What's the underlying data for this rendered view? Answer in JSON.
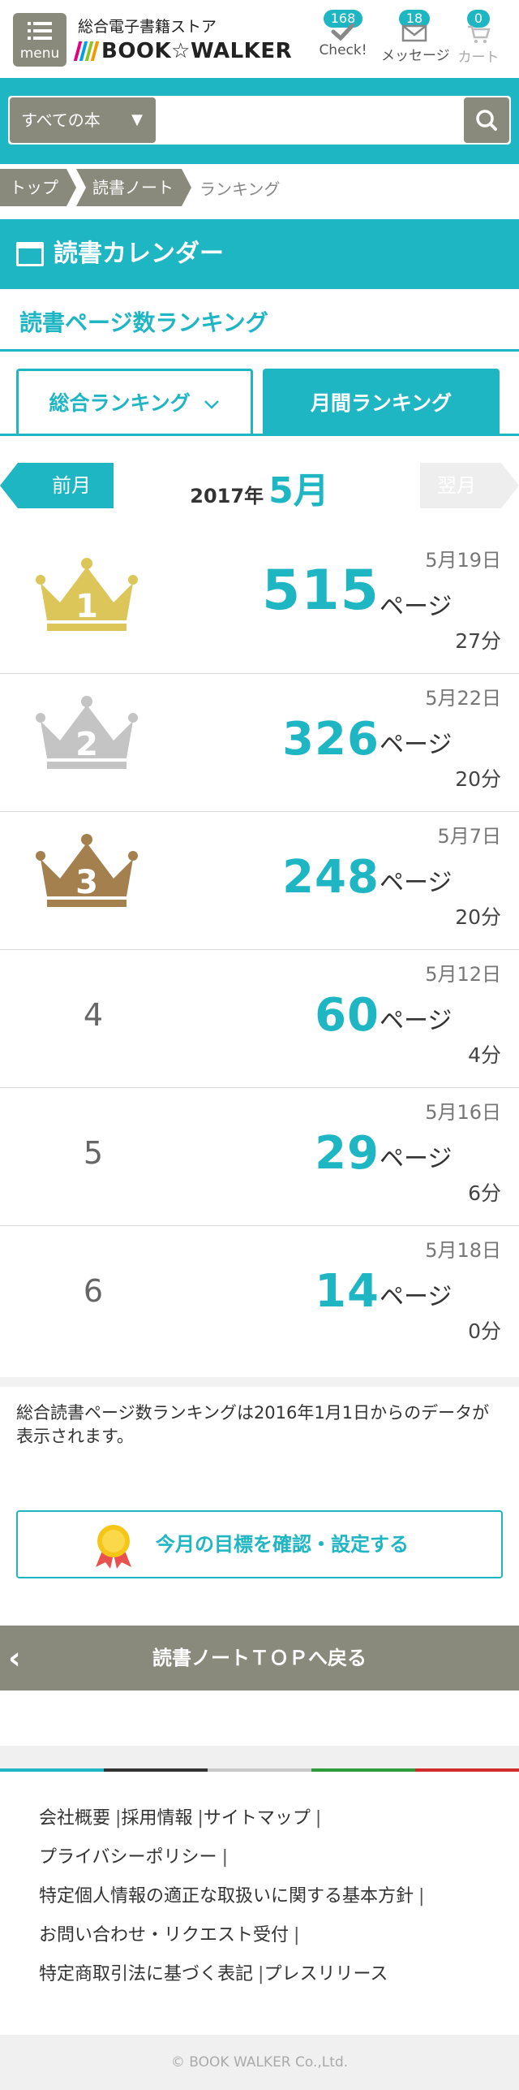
{
  "header": {
    "menu_label": "menu",
    "store_subtitle": "総合電子書籍ストア",
    "logo_text": "BOOK☆WALKER",
    "check": {
      "badge": "168",
      "label": "Check!"
    },
    "messages": {
      "badge": "18",
      "label": "メッセージ"
    },
    "cart": {
      "badge": "0",
      "label": "カート"
    }
  },
  "search": {
    "category": "すべての本",
    "placeholder": ""
  },
  "breadcrumb": {
    "items": [
      "トップ",
      "読書ノート"
    ],
    "current": "ランキング"
  },
  "section": {
    "title": "読書カレンダー",
    "subtitle": "読書ページ数ランキング"
  },
  "tabs": {
    "overall": "総合ランキング",
    "monthly": "月間ランキング"
  },
  "month_nav": {
    "prev": "前月",
    "next": "翌月",
    "year": "2017年",
    "month": "5月"
  },
  "rankings": [
    {
      "rank": "1",
      "date": "5月19日",
      "pages": "515",
      "unit": "ページ",
      "minutes": "27分"
    },
    {
      "rank": "2",
      "date": "5月22日",
      "pages": "326",
      "unit": "ページ",
      "minutes": "20分"
    },
    {
      "rank": "3",
      "date": "5月7日",
      "pages": "248",
      "unit": "ページ",
      "minutes": "20分"
    },
    {
      "rank": "4",
      "date": "5月12日",
      "pages": "60",
      "unit": "ページ",
      "minutes": "4分"
    },
    {
      "rank": "5",
      "date": "5月16日",
      "pages": "29",
      "unit": "ページ",
      "minutes": "6分"
    },
    {
      "rank": "6",
      "date": "5月18日",
      "pages": "14",
      "unit": "ページ",
      "minutes": "0分"
    }
  ],
  "note": "総合読書ページ数ランキングは2016年1月1日からのデータが表示されます。",
  "goal_button": "今月の目標を確認・設定する",
  "back_button": "読書ノートＴＯＰへ戻る",
  "footer": {
    "lines": [
      [
        "会社概要",
        "採用情報",
        "サイトマップ"
      ],
      [
        "プライバシーポリシー"
      ],
      [
        "特定個人情報の適正な取扱いに関する基本方針"
      ],
      [
        "お問い合わせ・リクエスト受付"
      ],
      [
        "特定商取引法に基づく表記",
        "プレスリリース"
      ]
    ],
    "copyright": "© BOOK WALKER Co.,Ltd."
  },
  "colors": {
    "accent": "#1fb6c4",
    "neutral": "#8a8a7c",
    "gold": "#dcc65a",
    "silver": "#c4c4c4",
    "bronze": "#a4804f"
  }
}
